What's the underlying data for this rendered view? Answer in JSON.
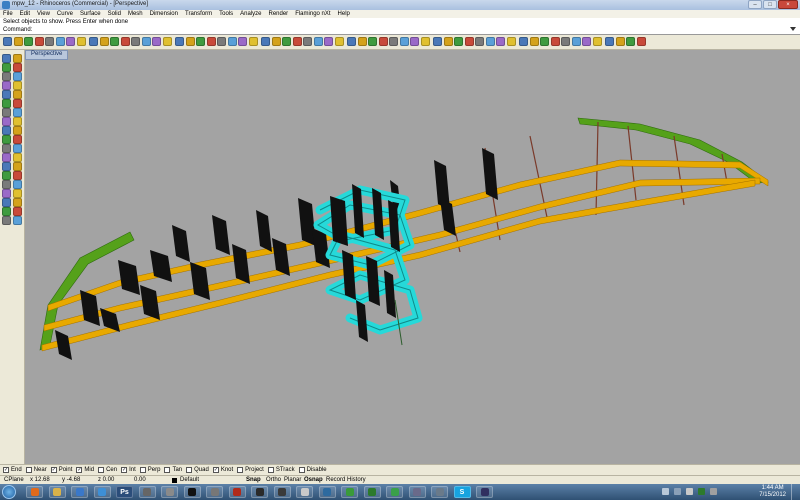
{
  "window": {
    "title": "mpw_12 - Rhinoceros (Commercial) - [Perspective]",
    "buttons": [
      "–",
      "□",
      "×"
    ]
  },
  "menu": [
    "File",
    "Edit",
    "View",
    "Curve",
    "Surface",
    "Solid",
    "Mesh",
    "Dimension",
    "Transform",
    "Tools",
    "Analyze",
    "Render",
    "Flamingo nXt",
    "Help"
  ],
  "command_history": "Select objects to show. Press Enter when done",
  "command_prompt": {
    "label": "Command:",
    "value": ""
  },
  "viewport": {
    "tab_label": "Perspective",
    "background": "#a3a3a3"
  },
  "model_colors": {
    "ribs": "#e8a900",
    "fins": "#111111",
    "end_arcs": "#55a11a",
    "helix": "#26d9d9",
    "spokes": "#7a3a2a"
  },
  "osnaps": [
    {
      "label": "End",
      "checked": true
    },
    {
      "label": "Near",
      "checked": false
    },
    {
      "label": "Point",
      "checked": true
    },
    {
      "label": "Mid",
      "checked": true
    },
    {
      "label": "Cen",
      "checked": false
    },
    {
      "label": "Int",
      "checked": true
    },
    {
      "label": "Perp",
      "checked": false
    },
    {
      "label": "Tan",
      "checked": false
    },
    {
      "label": "Quad",
      "checked": false
    },
    {
      "label": "Knot",
      "checked": true
    },
    {
      "label": "Project",
      "checked": false
    },
    {
      "label": "STrack",
      "checked": false
    },
    {
      "label": "Disable",
      "checked": false
    }
  ],
  "status": {
    "cplane": "CPlane",
    "x": "x 12.68",
    "y": "y -4.68",
    "z": "z 0.00",
    "dist": "0.00",
    "layer": "Default",
    "panes": [
      "Snap",
      "Ortho",
      "Planar",
      "Osnap",
      "Record History"
    ]
  },
  "taskbar": {
    "apps": [
      {
        "name": "firefox",
        "color": "#e06a1b"
      },
      {
        "name": "explorer",
        "color": "#d9b24a"
      },
      {
        "name": "media-player",
        "color": "#3a78c9"
      },
      {
        "name": "ie",
        "color": "#3d8fd6"
      },
      {
        "name": "photoshop",
        "label": "Ps",
        "color": "#2b4d7a"
      },
      {
        "name": "app-6",
        "color": "#666666"
      },
      {
        "name": "app-7",
        "color": "#8a8a8a"
      },
      {
        "name": "sketch",
        "color": "#111111"
      },
      {
        "name": "app-9",
        "color": "#777777"
      },
      {
        "name": "app-10",
        "color": "#b02a1a"
      },
      {
        "name": "app-11",
        "color": "#2a2a2a"
      },
      {
        "name": "rhino",
        "color": "#3a3a3a"
      },
      {
        "name": "app-13",
        "color": "#c9c9c9"
      },
      {
        "name": "app-14",
        "color": "#2d6a9f"
      },
      {
        "name": "app-15",
        "color": "#3a9a3a"
      },
      {
        "name": "app-16",
        "color": "#2c7a2c"
      },
      {
        "name": "app-17",
        "color": "#3aa04a"
      },
      {
        "name": "app-18",
        "color": "#6a6a8a"
      },
      {
        "name": "app-19",
        "color": "#6a7a8a"
      },
      {
        "name": "skype",
        "label": "S",
        "color": "#17a3e0"
      },
      {
        "name": "app-21",
        "color": "#303060"
      }
    ],
    "time": "1:44 AM",
    "date": "7/15/2012"
  }
}
